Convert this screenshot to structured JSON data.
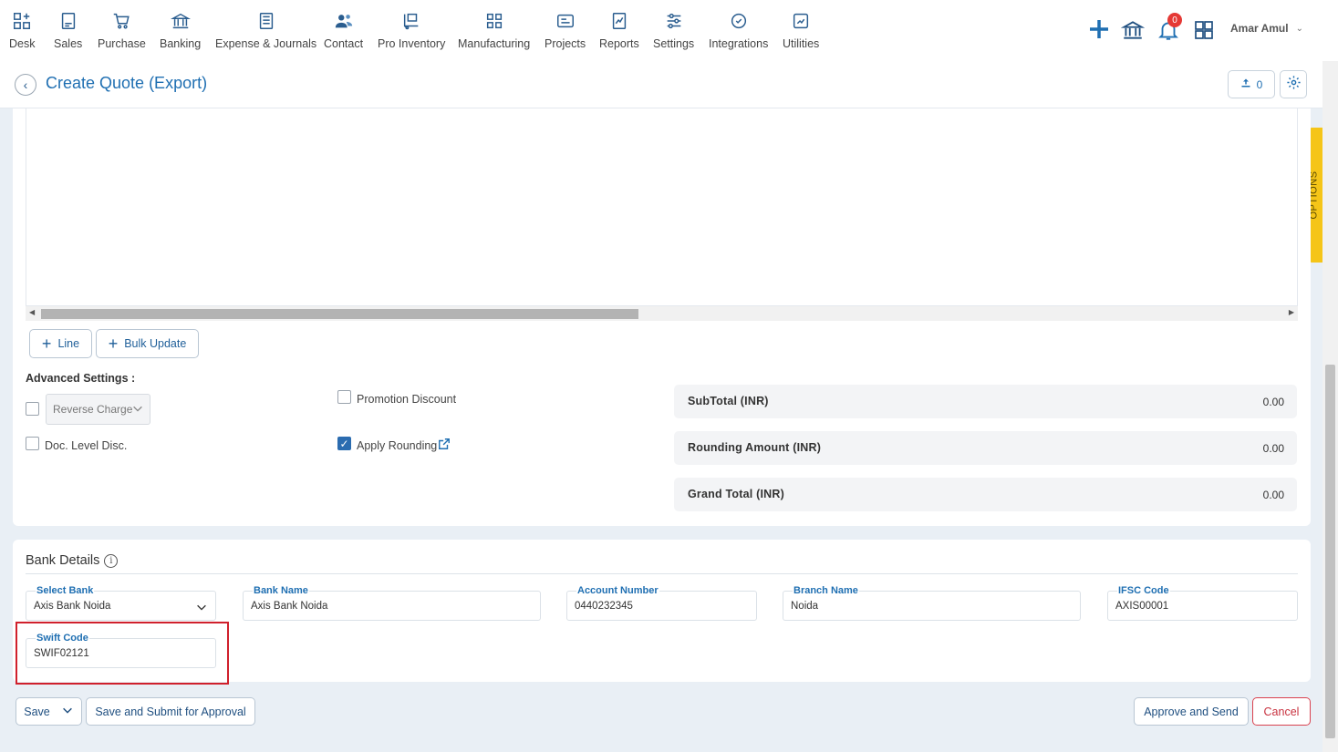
{
  "nav": {
    "items": [
      {
        "label": "Desk",
        "icon": "desk-icon"
      },
      {
        "label": "Sales",
        "icon": "sales-icon"
      },
      {
        "label": "Purchase",
        "icon": "purchase-cart-icon"
      },
      {
        "label": "Banking",
        "icon": "bank-icon"
      },
      {
        "label": "Expense & Journals",
        "icon": "journal-icon"
      },
      {
        "label": "Contact",
        "icon": "contacts-icon"
      },
      {
        "label": "Pro Inventory",
        "icon": "inventory-icon"
      },
      {
        "label": "Manufacturing",
        "icon": "manufacturing-icon"
      },
      {
        "label": "Projects",
        "icon": "projects-icon"
      },
      {
        "label": "Reports",
        "icon": "reports-icon"
      },
      {
        "label": "Settings",
        "icon": "settings-sliders-icon"
      },
      {
        "label": "Integrations",
        "icon": "integrations-icon"
      },
      {
        "label": "Utilities",
        "icon": "utilities-icon"
      }
    ],
    "notification_count": "0",
    "user_name": "Amar Amul"
  },
  "page": {
    "title": "Create Quote (Export)",
    "upload_count": "0",
    "options_tab": "OPTIONS"
  },
  "lines": {
    "add_line": "Line",
    "bulk_update": "Bulk Update"
  },
  "advanced": {
    "heading": "Advanced Settings :",
    "reverse_charge": "Reverse Charge",
    "doc_level_disc": "Doc. Level Disc.",
    "promotion_discount": "Promotion Discount",
    "apply_rounding": "Apply Rounding",
    "reverse_charge_checked": false,
    "doc_level_disc_checked": false,
    "promotion_discount_checked": false,
    "apply_rounding_checked": true
  },
  "totals": {
    "subtotal_label": "SubTotal (INR)",
    "subtotal_value": "0.00",
    "rounding_label": "Rounding Amount (INR)",
    "rounding_value": "0.00",
    "grand_label": "Grand Total (INR)",
    "grand_value": "0.00"
  },
  "bank": {
    "title": "Bank Details",
    "select_bank_label": "Select Bank",
    "select_bank_value": "Axis Bank Noida",
    "bank_name_label": "Bank Name",
    "bank_name_value": "Axis Bank Noida",
    "account_number_label": "Account Number",
    "account_number_value": "0440232345",
    "branch_name_label": "Branch Name",
    "branch_name_value": "Noida",
    "ifsc_label": "IFSC Code",
    "ifsc_value": "AXIS00001",
    "swift_label": "Swift Code",
    "swift_value": "SWIF02121"
  },
  "footer": {
    "save": "Save",
    "save_submit": "Save and Submit for Approval",
    "approve_send": "Approve and Send",
    "cancel": "Cancel"
  },
  "colors": {
    "accent": "#1f6fb2",
    "options_tab": "#f5c518",
    "cancel": "#c8323f",
    "highlight": "#d0202c",
    "notification": "#e53935"
  }
}
